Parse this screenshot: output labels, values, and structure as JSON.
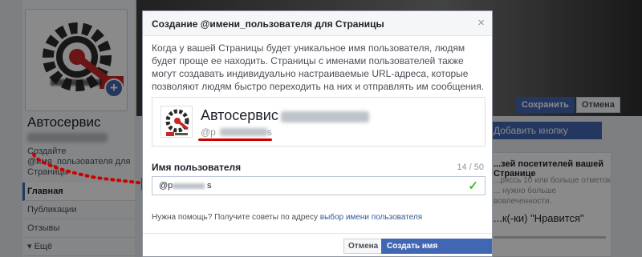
{
  "background": {
    "page_name": "Автосервис",
    "create_username": "Создайте @имя_пользователя для Страницы",
    "nav_items": [
      "Главная",
      "Публикации",
      "Отзывы",
      "Ещё"
    ],
    "save_label": "Сохранить",
    "cancel_label": "Отмена",
    "add_button_label": "Добавить кнопку",
    "right_card_title": "...зей посетителей вашей Странице",
    "right_card_sub": "...ряссь 10 или больше отметок ... нужно больше вовлеченности.",
    "right_card_likes": "...к(-ки) \"Нравится\""
  },
  "modal": {
    "title": "Создание @имени_пользователя для Страницы",
    "close_glyph": "×",
    "description": "Когда у вашей Страницы будет уникальное имя пользователя, людям будет проще ее находить. Страницы с именами пользователей также могут создавать индивидуально настраиваемые URL-адреса, которые позволяют людям быстро переходить на них и отправлять им сообщения.",
    "preview_name": "Автосервис",
    "preview_user_prefix": "@p",
    "preview_user_suffix": "s",
    "field_label": "Имя пользователя",
    "field_count": "14 / 50",
    "field_prefix": "@p",
    "field_suffix": "s",
    "help_text": "Нужна помощь? Получите советы по адресу",
    "help_link": "выбор имени пользователя",
    "cancel_button": "Отмена",
    "create_button": "Создать имя пользователя"
  },
  "colors": {
    "accent": "#4267b2",
    "annotation": "#cc0000",
    "valid": "#42b72a"
  }
}
